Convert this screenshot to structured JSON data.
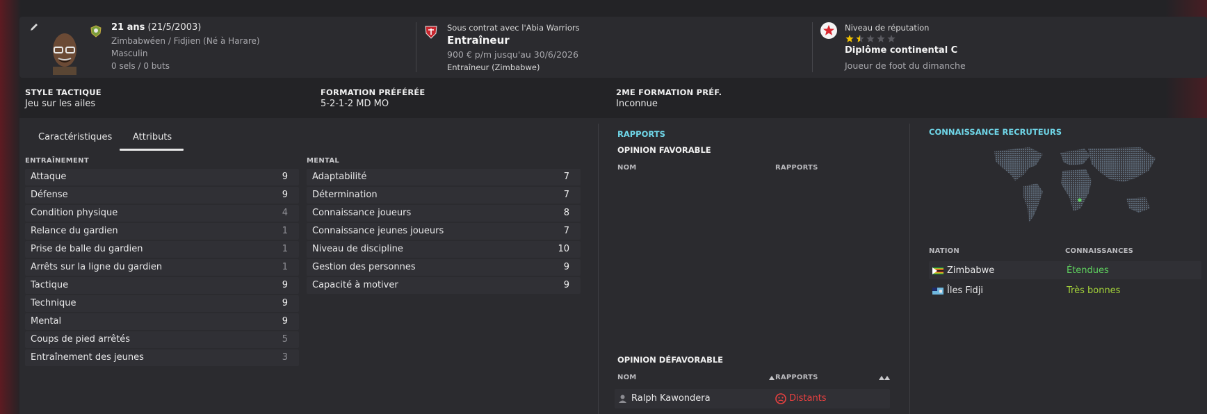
{
  "header": {
    "age": "21 ans",
    "dob": "(21/5/2003)",
    "nationality": "Zimbabwéen / Fidjien (Né à Harare)",
    "gender": "Masculin",
    "caps": "0 sels / 0 buts",
    "contract_line": "Sous contrat avec l'Abia Warriors",
    "role": "Entraîneur",
    "salary": "900 € p/m jusqu'au 30/6/2026",
    "role_detail": "Entraîneur (Zimbabwe)",
    "reputation_label": "Niveau de réputation",
    "reputation_stars": 1.5,
    "reputation_max": 5,
    "license": "Diplôme continental C",
    "playing_level": "Joueur de foot du dimanche"
  },
  "tactics": {
    "style_label": "STYLE TACTIQUE",
    "style_value": "Jeu sur les ailes",
    "formation_label": "FORMATION PRÉFÉRÉE",
    "formation_value": "5-2-1-2 MD MO",
    "formation2_label": "2ME FORMATION PRÉF.",
    "formation2_value": "Inconnue"
  },
  "tabs": [
    {
      "label": "Caractéristiques",
      "active": false
    },
    {
      "label": "Attributs",
      "active": true
    }
  ],
  "training": {
    "title": "ENTRAÎNEMENT",
    "items": [
      {
        "name": "Attaque",
        "value": "9"
      },
      {
        "name": "Défense",
        "value": "9"
      },
      {
        "name": "Condition physique",
        "value": "4"
      },
      {
        "name": "Relance du gardien",
        "value": "1"
      },
      {
        "name": "Prise de balle du gardien",
        "value": "1"
      },
      {
        "name": "Arrêts sur la ligne du gardien",
        "value": "1"
      },
      {
        "name": "Tactique",
        "value": "9"
      },
      {
        "name": "Technique",
        "value": "9"
      },
      {
        "name": "Mental",
        "value": "9"
      },
      {
        "name": "Coups de pied arrêtés",
        "value": "5"
      },
      {
        "name": "Entraînement des jeunes",
        "value": "3"
      }
    ]
  },
  "mental": {
    "title": "MENTAL",
    "items": [
      {
        "name": "Adaptabilité",
        "value": "7"
      },
      {
        "name": "Détermination",
        "value": "7"
      },
      {
        "name": "Connaissance joueurs",
        "value": "8"
      },
      {
        "name": "Connaissance jeunes joueurs",
        "value": "7"
      },
      {
        "name": "Niveau de discipline",
        "value": "10"
      },
      {
        "name": "Gestion des personnes",
        "value": "9"
      },
      {
        "name": "Capacité à motiver",
        "value": "9"
      }
    ]
  },
  "reports": {
    "title": "RAPPORTS",
    "favorable_title": "OPINION FAVORABLE",
    "col_name": "NOM",
    "col_reports": "RAPPORTS",
    "unfavorable_title": "OPINION DÉFAVORABLE",
    "unfavorable_rows": [
      {
        "name": "Ralph Kawondera",
        "report": "Distants"
      }
    ]
  },
  "scouting": {
    "title": "CONNAISSANCE RECRUTEURS",
    "col_nation": "NATION",
    "col_knowledge": "CONNAISSANCES",
    "rows": [
      {
        "nation": "Zimbabwe",
        "knowledge": "Étendues"
      },
      {
        "nation": "Îles Fidji",
        "knowledge": "Très bonnes"
      }
    ]
  },
  "colors": {
    "accent_cyan": "#6fd6e8",
    "knowledge_green": "#5fd35f",
    "knowledge_lime": "#a5d43a",
    "report_red": "#e84040",
    "star_gold": "#f2c200"
  }
}
